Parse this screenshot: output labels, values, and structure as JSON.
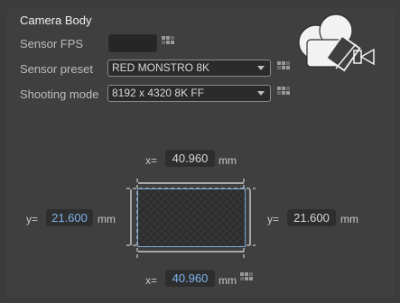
{
  "section": {
    "title": "Camera Body"
  },
  "rows": {
    "fps_label": "Sensor FPS",
    "preset_label": "Sensor preset",
    "mode_label": "Shooting mode"
  },
  "sensor_fps": {
    "value": ""
  },
  "sensor_preset": {
    "selected": "RED MONSTRO 8K"
  },
  "shooting_mode": {
    "selected": "8192 x 4320 8K FF"
  },
  "dimensions": {
    "top": {
      "label": "x=",
      "value": "40.960",
      "unit": "mm"
    },
    "left": {
      "label": "y=",
      "value": "21.600",
      "unit": "mm"
    },
    "right": {
      "label": "y=",
      "value": "21.600",
      "unit": "mm"
    },
    "bottom": {
      "label": "x=",
      "value": "40.960",
      "unit": "mm"
    }
  },
  "icons": {
    "camera": "camera-icon",
    "keyframe": "keyframe-icon"
  },
  "colors": {
    "accent_blue": "#7fb4ee",
    "panel": "#3f3f3f"
  }
}
